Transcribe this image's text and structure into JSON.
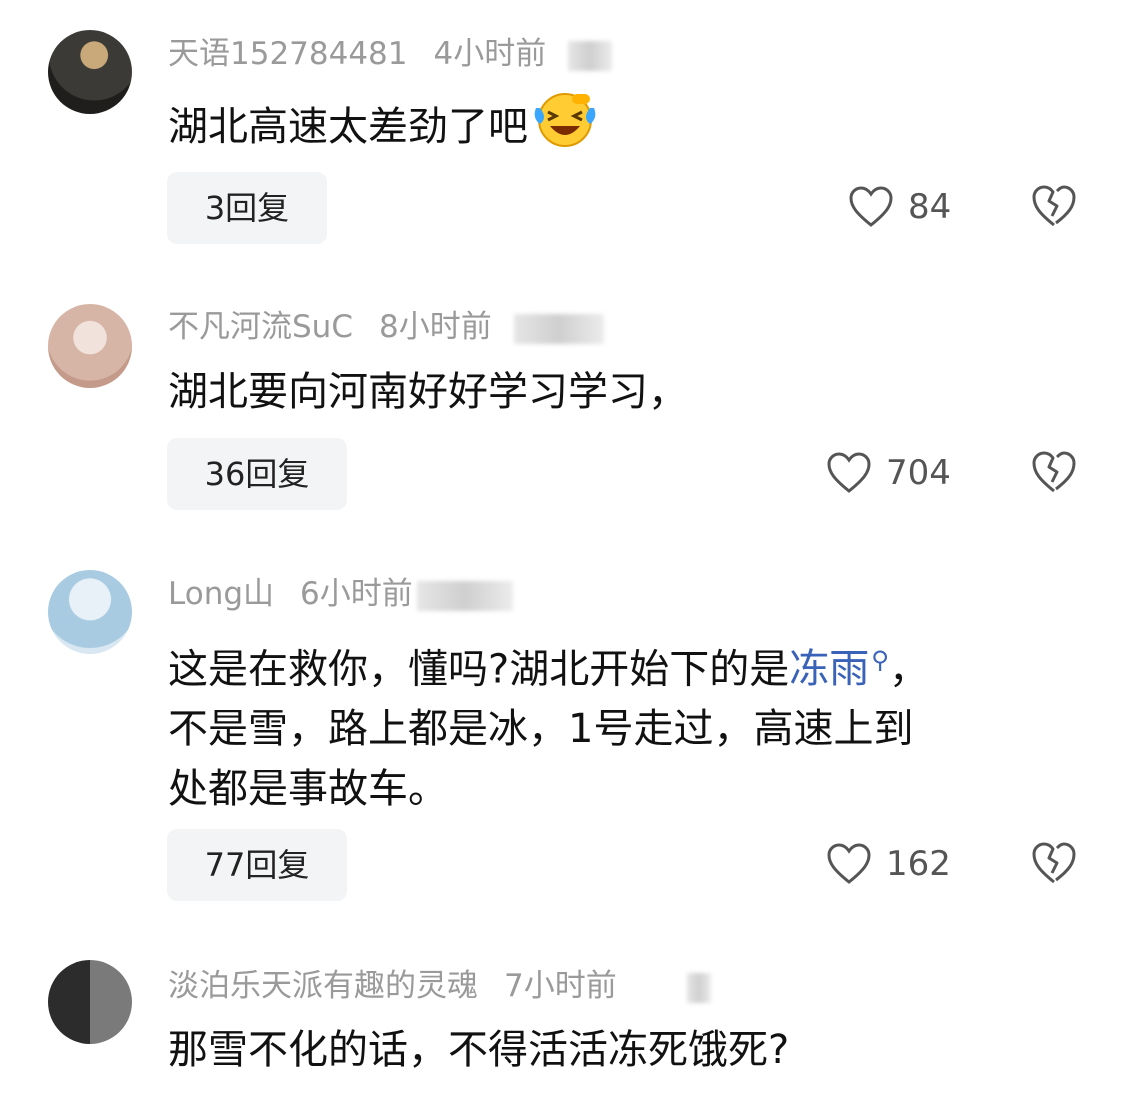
{
  "comments": [
    {
      "user": "天语152784481",
      "time": "4小时前",
      "text": "湖北高速太差劲了吧",
      "emoji": "grinning-squinting-tears-icon",
      "reply_label": "3回复",
      "likes": "84",
      "avatar_colors": [
        "#3c3a36",
        "#c9a979"
      ]
    },
    {
      "user": "不凡河流SuC",
      "time": "8小时前",
      "text": "湖北要向河南好好学习学习，",
      "reply_label": "36回复",
      "likes": "704",
      "avatar_colors": [
        "#d7b5a6",
        "#f1e2db"
      ]
    },
    {
      "user": "Long山",
      "time": "6小时前",
      "text_before": "这是在救你，懂吗?湖北开始下的是",
      "keyword": "冻雨",
      "text_line1_end": "，",
      "text_rest_1": "不是雪，路上都是冰，1号走过，高速上到",
      "text_rest_2": "处都是事故车。",
      "reply_label": "77回复",
      "likes": "162",
      "avatar_colors": [
        "#a9cbe2",
        "#e8f1f7"
      ]
    },
    {
      "user": "淡泊乐天派有趣的灵魂",
      "time": "7小时前",
      "text": "那雪不化的话，不得活活冻死饿死?",
      "avatar_colors": [
        "#2c2c2c",
        "#7a7a7a"
      ]
    }
  ],
  "colors": {
    "meta_gray": "#9a9a9a",
    "keyword_blue": "#3a62b8",
    "reply_bg": "#f3f4f6"
  },
  "icons": {
    "like": "heart-outline-icon",
    "dislike": "broken-heart-icon",
    "search": "search-icon"
  }
}
